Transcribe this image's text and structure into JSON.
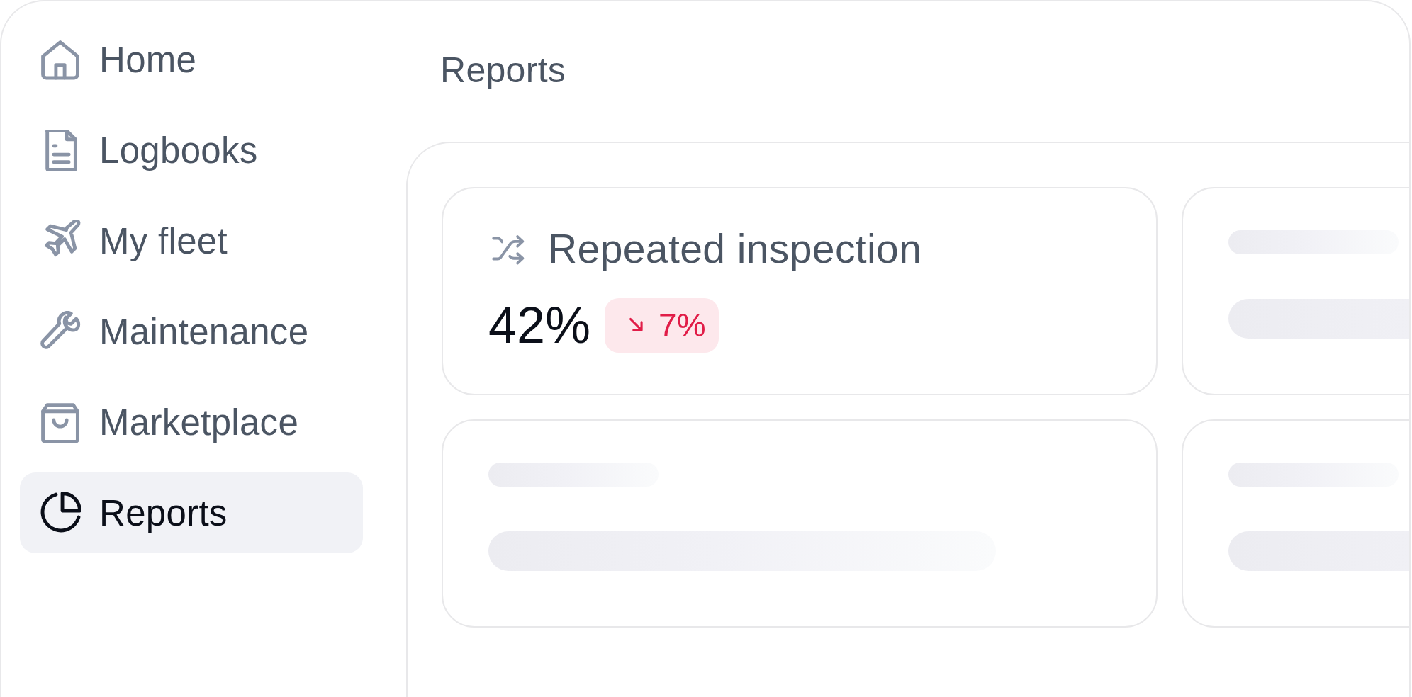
{
  "sidebar": {
    "items": [
      {
        "label": "Home",
        "selected": false
      },
      {
        "label": "Logbooks",
        "selected": false
      },
      {
        "label": "My fleet",
        "selected": false
      },
      {
        "label": "Maintenance",
        "selected": false
      },
      {
        "label": "Marketplace",
        "selected": false
      },
      {
        "label": "Reports",
        "selected": true
      }
    ]
  },
  "page": {
    "title": "Reports"
  },
  "cards": [
    {
      "kind": "metric",
      "title": "Repeated inspection",
      "value": "42%",
      "change": {
        "negative": true,
        "text": "7%"
      }
    },
    {
      "kind": "placeholder"
    },
    {
      "kind": "placeholder"
    },
    {
      "kind": "placeholder"
    }
  ]
}
